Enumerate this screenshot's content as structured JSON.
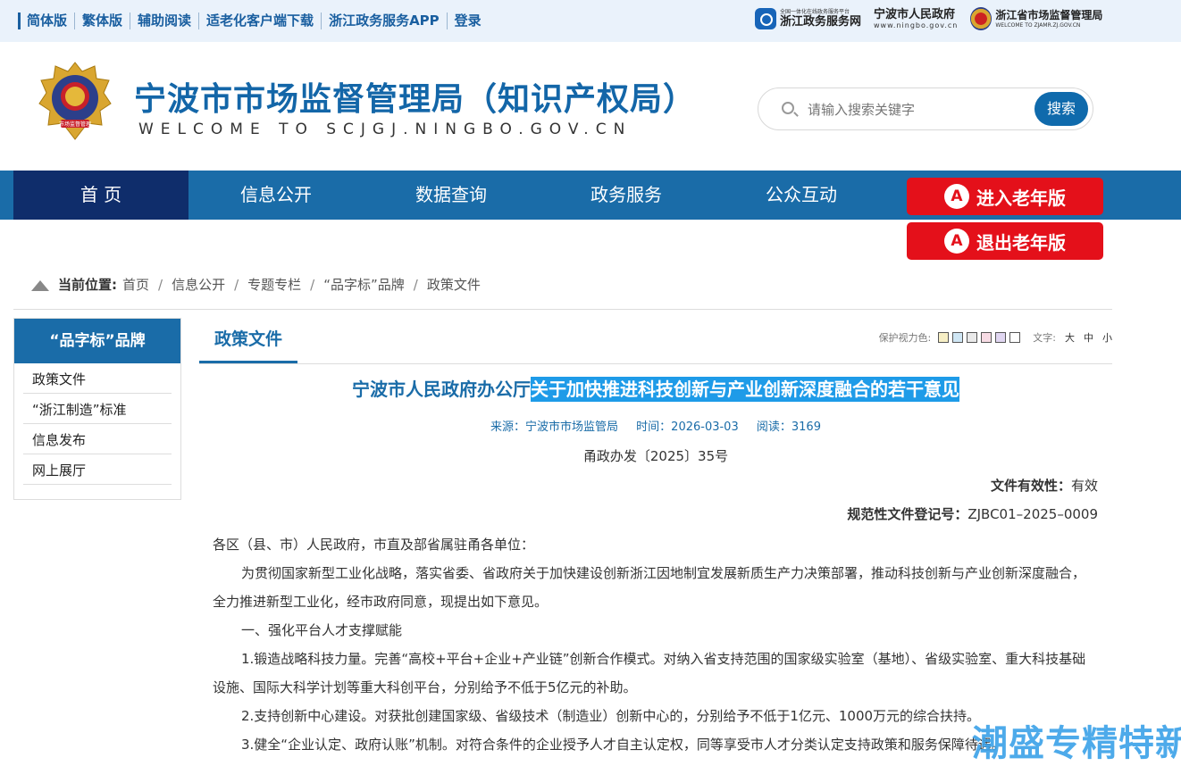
{
  "topbar": {
    "links": [
      "简体版",
      "繁体版",
      "辅助阅读",
      "适老化客户端下载",
      "浙江政务服务APP",
      "登录"
    ],
    "logo1_small": "全国一体化在线政务服务平台",
    "logo1_big": "浙江政务服务网",
    "logo2_big": "宁波市人民政府",
    "logo2_small": "www.ningbo.gov.cn",
    "logo3_big": "浙江省市场监督管理局",
    "logo3_small": "WELCOME TO ZJAMR.ZJ.GOV.CN"
  },
  "header": {
    "title": "宁波市市场监督管理局（知识产权局）",
    "subtitle": "WELCOME TO SCJGJ.NINGBO.GOV.CN",
    "search_placeholder": "请输入搜索关键字",
    "search_button": "搜索",
    "emblem_text": "市场监督管理"
  },
  "nav": {
    "items": [
      "首 页",
      "信息公开",
      "数据查询",
      "政务服务",
      "公众互动"
    ],
    "elder_enter": "进入老年版",
    "elder_exit": "退出老年版",
    "elder_icon": "A"
  },
  "breadcrumb": {
    "label": "当前位置:",
    "items": [
      "首页",
      "信息公开",
      "专题专栏",
      "“品字标”品牌",
      "政策文件"
    ],
    "sep": "/"
  },
  "sidebar": {
    "title": "“品字标”品牌",
    "items": [
      "政策文件",
      "“浙江制造”标准",
      "信息发布",
      "网上展厅"
    ]
  },
  "tab": {
    "label": "政策文件",
    "color_label": "保护视力色:",
    "text_label": "文字:",
    "sizes": [
      "大",
      "中",
      "小"
    ],
    "swatches": [
      "#f7efc5",
      "#cfe6f4",
      "#e9e9e9",
      "#f7dbe4",
      "#e0d6f1",
      "#ffffff"
    ]
  },
  "article": {
    "title_plain": "宁波市人民政府办公厅",
    "title_highlight": "关于加快推进科技创新与产业创新深度融合的若干意见",
    "source": "来源：宁波市市场监管局",
    "time": "时间：2026-03-03",
    "reads": "阅读：3169",
    "doc_no": "甬政办发〔2025〕35号",
    "validity_label": "文件有效性：",
    "validity_value": "有效",
    "reg_label": "规范性文件登记号：",
    "reg_value": "ZJBC01–2025–0009",
    "paragraphs": [
      "各区（县、市）人民政府，市直及部省属驻甬各单位：",
      "为贯彻国家新型工业化战略，落实省委、省政府关于加快建设创新浙江因地制宜发展新质生产力决策部署，推动科技创新与产业创新深度融合，全力推进新型工业化，经市政府同意，现提出如下意见。",
      "一、强化平台人才支撑赋能",
      "1.锻造战略科技力量。完善“高校+平台+企业+产业链”创新合作模式。对纳入省支持范围的国家级实验室（基地）、省级实验室、重大科技基础设施、国际大科学计划等重大科创平台，分别给予不低于5亿元的补助。",
      "2.支持创新中心建设。对获批创建国家级、省级技术（制造业）创新中心的，分别给予不低于1亿元、1000万元的综合扶持。",
      "3.健全“企业认定、政府认账”机制。对符合条件的企业授予人才自主认定权，同等享受市人才分类认定支持政策和服务保障待遇。"
    ]
  },
  "watermark": "潮盛专精特新"
}
